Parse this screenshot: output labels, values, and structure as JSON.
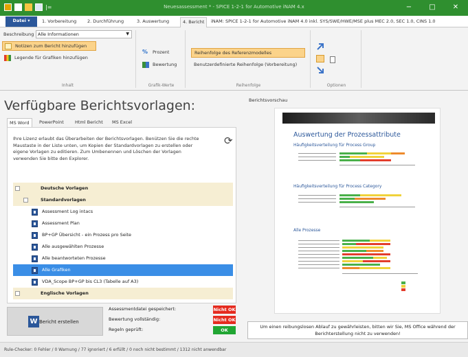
{
  "window": {
    "title": "Neuesassessment * - SPICE 1-2-1 for Automotive iNAM 4.x",
    "minimize": "−",
    "maximize": "□",
    "close": "✕",
    "qa_more": "|="
  },
  "ribbon_tabs": [
    {
      "label": "Datei ▾"
    },
    {
      "label": "1. Vorbereitung"
    },
    {
      "label": "2. Durchführung"
    },
    {
      "label": "3. Auswertung"
    },
    {
      "label": "4. Bericht"
    },
    {
      "label": "iNAM: SPICE 1-2-1 for Automotive iNAM 4.0 inkl. SYS/SWE/HWE/MSE plus MEC 2.0, SEC 1.0, CINS 1.0"
    }
  ],
  "ribbon": {
    "beschreibung_label": "Beschreibung",
    "beschreibung_value": "Alle Informationen",
    "notizen_button": "Notizen zum Bericht hinzufügen",
    "legende_button": "Legende für Grafiken hinzufügen",
    "group_inhalt": "Inhalt",
    "prozent_button": "Prozent",
    "bewertung_button": "Bewertung",
    "group_grafik": "Grafik-Werte",
    "reihenfolge_ref_button": "Reihenfolge des Referenzmodelles",
    "reihenfolge_user_button": "Benutzerdefinierte Reihenfolge (Vorbereitung)",
    "group_reihenfolge": "Reihenfolge",
    "group_optionen": "Optionen"
  },
  "left": {
    "title": "Verfügbare Berichtsvorlagen:",
    "subtabs": [
      "MS Word",
      "PowerPoint",
      "Html Bericht",
      "MS Excel"
    ],
    "info_text": "Ihre Lizenz erlaubt das Überarbeiten der Berichtsvorlagen. Benützen Sie die rechte Maustaste in der Liste unten, um Kopien der Standardvorlagen zu erstellen oder eigene Vorlagen zu editieren. Zum Umbenennen und Löschen der Vorlagen verwenden Sie bitte den Explorer.",
    "refresh_icon": "⟳",
    "tree": {
      "group_de": "Deutsche Vorlagen",
      "group_std": "Standardvorlagen",
      "items": [
        "Assessment Log intacs",
        "Assessment Plan",
        "BP+GP Übersicht - ein Prozess pro Seite",
        "Alle ausgewählten Prozesse",
        "Alle beantworteten Prozesse",
        "Alle Grafiken",
        "VDA_Scope BP+GP bis CL3 (Tabelle auf A3)"
      ],
      "group_en": "Englische Vorlagen"
    },
    "word_button": "Bericht erstellen",
    "word_icon": "W",
    "status": [
      {
        "label": "Assessmentdatei gespeichert:",
        "value": "Nicht OK",
        "ok": false
      },
      {
        "label": "Bewertung vollständig:",
        "value": "Nicht OK",
        "ok": false
      },
      {
        "label": "Regeln geprüft:",
        "value": "OK",
        "ok": true
      }
    ]
  },
  "right": {
    "label": "Berichtsvorschau",
    "preview_title": "Auswertung der Prozessattribute",
    "preview_h_group": "Häufigkeitsverteilung für Process Group",
    "preview_h_category": "Häufigkeitsverteilung für Process Category",
    "preview_h_all": "Alle Prozesse",
    "notice": "Um einen reibungslosen Ablauf zu gewährleisten, bitten wir Sie, MS Office während der Berichterstellung nicht zu verwenden!"
  },
  "statusbar": "Rule-Checker: 0 Fehler / 0 Warnung / 77 ignoriert / 6 erfüllt / 0 noch nicht bestimmt / 1312 nicht anwendbar",
  "colors": {
    "titlebar": "#2f8f2f",
    "file_tab": "#2b579a",
    "ribbon_highlight": "#fbd38a",
    "tree_header": "#f6eed3",
    "tree_selected": "#3a8ee6",
    "status_bad": "#e52b1f",
    "status_good": "#21a633"
  }
}
